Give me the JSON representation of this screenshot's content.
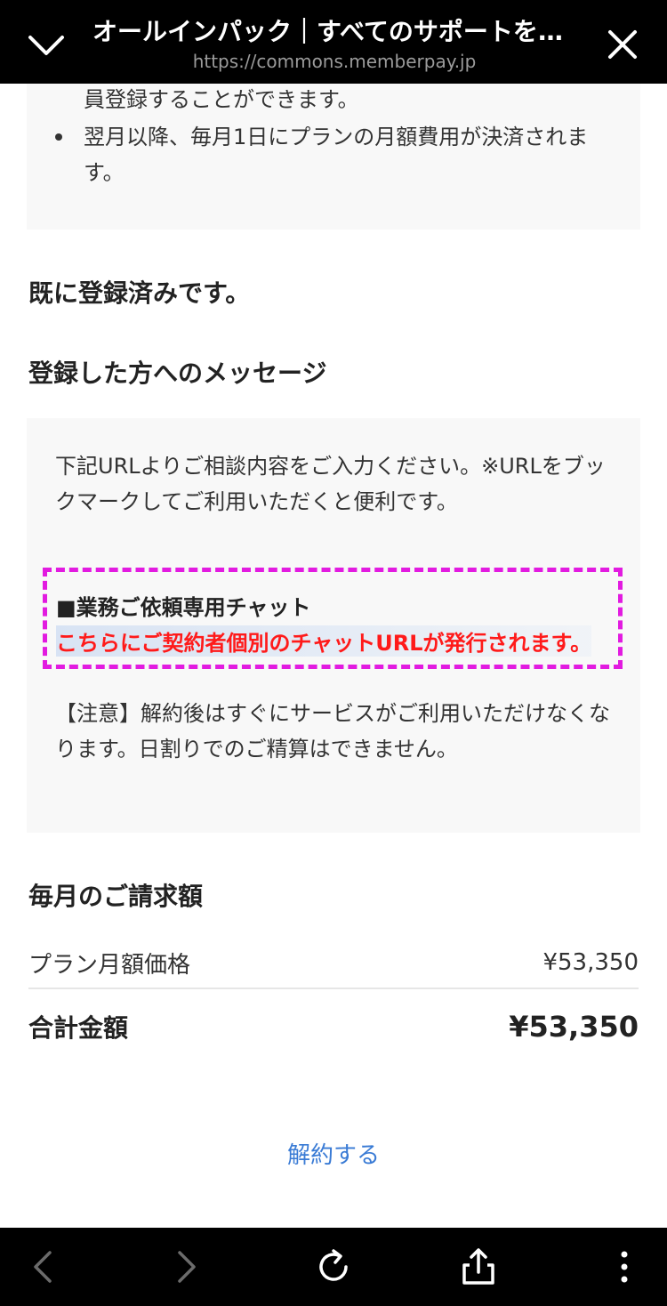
{
  "header": {
    "title": "オールインパック｜すべてのサポートを利…",
    "url": "https://commons.memberpay.jp"
  },
  "notes": {
    "line_fragment": "員登録することができます。",
    "bullet": "翌月以降、毎月1日にプランの月額費用が決済されます。"
  },
  "status": {
    "registered_heading": "既に登録済みです。"
  },
  "message": {
    "heading": "登録した方へのメッセージ",
    "intro": "下記URLよりご相談内容をご入力ください。※URLをブックマークしてご利用いただくと便利です。",
    "chat_label": "■業務ご依頼専用チャット",
    "chat_url_text": "こちらにご契約者個別のチャットURLが発行されます。",
    "caution": "【注意】解約後はすぐにサービスがご利用いただけなくなります。日割りでのご精算はできません。"
  },
  "billing": {
    "heading": "毎月のご請求額",
    "plan_label": "プラン月額価格",
    "plan_price": "¥53,350",
    "total_label": "合計金額",
    "total_price": "¥53,350"
  },
  "actions": {
    "cancel_label": "解約する"
  },
  "toolbar": {
    "icons": [
      "back-icon",
      "forward-icon",
      "reload-icon",
      "share-icon",
      "more-icon"
    ]
  },
  "colors": {
    "chat_url": "#ff1a1a",
    "highlight_border": "#e21be0",
    "link": "#3a7bd5"
  }
}
